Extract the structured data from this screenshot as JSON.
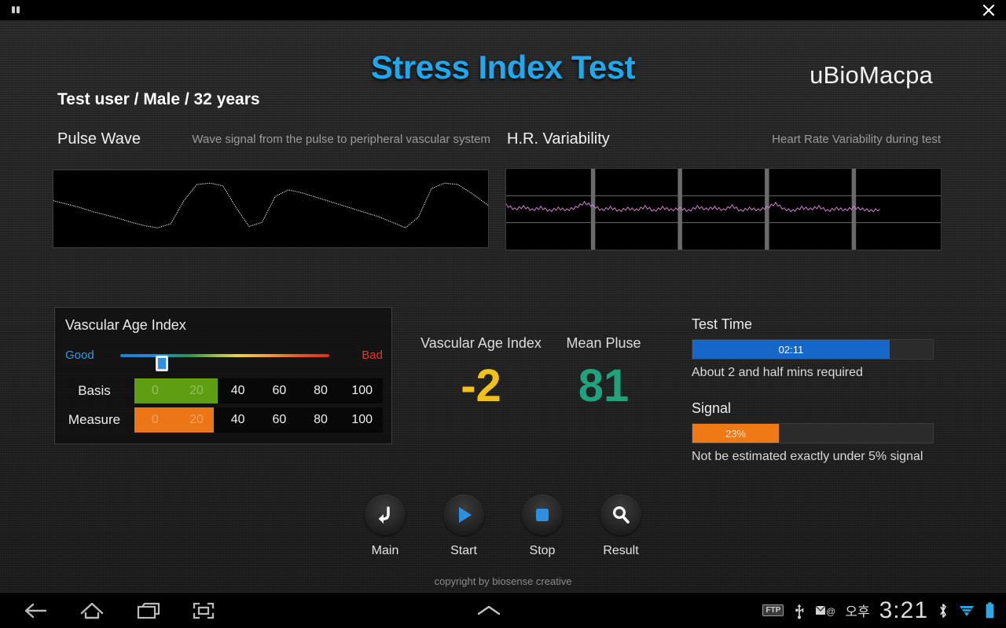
{
  "topbar": {
    "app_icon": "people-icon",
    "close_label": "close-icon"
  },
  "header": {
    "title": "Stress Index Test",
    "logo": "uBioMacpa",
    "user_info": "Test user / Male / 32 years",
    "accent_color": "#20a8ef"
  },
  "charts": {
    "pulse": {
      "title": "Pulse Wave",
      "subtitle": "Wave signal from the pulse to peripheral vascular system",
      "trace_color": "#ffffff"
    },
    "hrv": {
      "title": "H.R. Variability",
      "subtitle": "Heart Rate Variability during test",
      "trace_color": "#d07fd0",
      "grid_rows": 3,
      "grid_cols": 5
    }
  },
  "chart_data": [
    {
      "type": "line",
      "title": "Pulse Wave",
      "xlabel": "",
      "ylabel": "",
      "series": [
        {
          "name": "pulse",
          "color": "#ffffff",
          "x": [
            0,
            3,
            6,
            9,
            12,
            15,
            18,
            21,
            24,
            27,
            30,
            33,
            36,
            39,
            42,
            45,
            48,
            51,
            54,
            57,
            60,
            63,
            66,
            69,
            72,
            75,
            78,
            81,
            84,
            87,
            90,
            93,
            96,
            99,
            100
          ],
          "y": [
            62,
            57,
            52,
            46,
            41,
            36,
            30,
            25,
            22,
            28,
            62,
            86,
            88,
            84,
            52,
            24,
            30,
            68,
            78,
            74,
            68,
            62,
            56,
            50,
            44,
            38,
            30,
            22,
            38,
            80,
            88,
            86,
            74,
            60,
            55
          ]
        }
      ]
    },
    {
      "type": "line",
      "title": "H.R. Variability",
      "xlabel": "",
      "ylabel": "",
      "ylim": [
        0,
        100
      ],
      "grid": true,
      "series": [
        {
          "name": "hrv",
          "color": "#d07fd0",
          "x": [
            0,
            2,
            4,
            6,
            8,
            10,
            12,
            14,
            16,
            18,
            20,
            22,
            24,
            26,
            28,
            30,
            32,
            34,
            36,
            38,
            40,
            42,
            44,
            46,
            48,
            50,
            52,
            54,
            56,
            58,
            60,
            62,
            64,
            66,
            68,
            70,
            72,
            74,
            76,
            78,
            80,
            82,
            84,
            86
          ],
          "y": [
            55,
            50,
            53,
            49,
            52,
            48,
            51,
            49,
            52,
            58,
            54,
            49,
            52,
            48,
            51,
            49,
            53,
            48,
            52,
            49,
            51,
            48,
            53,
            50,
            52,
            49,
            54,
            48,
            51,
            49,
            52,
            57,
            50,
            48,
            52,
            50,
            53,
            48,
            51,
            49,
            52,
            50,
            48,
            50
          ]
        }
      ]
    }
  ],
  "vascular_panel": {
    "title": "Vascular Age Index",
    "slider": {
      "left_label": "Good",
      "right_label": "Bad",
      "value_percent": 20,
      "left_color": "#2e9bdc",
      "right_color": "#e03a2a"
    },
    "scale_labels": [
      "0",
      "20",
      "40",
      "60",
      "80",
      "100"
    ],
    "rows": [
      {
        "label": "Basis",
        "fill_percent": 33.5,
        "fill_color": "#5f9e12",
        "filled_cells": 2
      },
      {
        "label": "Measure",
        "fill_percent": 32.0,
        "fill_color": "#ec7615",
        "filled_cells": 2
      }
    ]
  },
  "readouts": [
    {
      "caption": "Vascular Age Index",
      "value": "-2",
      "color": "#f0c116"
    },
    {
      "caption": "Mean Pluse",
      "value": "81",
      "color": "#1fa37c"
    }
  ],
  "status_panel": {
    "test_time": {
      "label": "Test Time",
      "value": "02:11",
      "percent": 82,
      "note": "About 2 and half mins required",
      "color": "#1767c8"
    },
    "signal": {
      "label": "Signal",
      "value": "23%",
      "percent": 36,
      "note": "Not be estimated exactly under 5% signal",
      "color": "#ef7914"
    }
  },
  "controls": [
    {
      "label": "Main",
      "icon": "back-arrow-icon",
      "icon_color": "#ffffff"
    },
    {
      "label": "Start",
      "icon": "play-icon",
      "icon_color": "#2e8fe0"
    },
    {
      "label": "Stop",
      "icon": "stop-square-icon",
      "icon_color": "#2e8fe0"
    },
    {
      "label": "Result",
      "icon": "magnifier-icon",
      "icon_color": "#ffffff"
    }
  ],
  "copyright": "copyright by biosense creative",
  "navbar": {
    "buttons": [
      "back-icon",
      "home-icon",
      "recent-apps-icon",
      "screenshot-icon"
    ],
    "expand": "chevron-up-icon",
    "tray": {
      "ftp": "FTP",
      "usb": "usb-icon",
      "mail": "mail-at-icon",
      "ampm": "오후",
      "time": "3:21",
      "bluetooth": "bluetooth-icon",
      "wifi": "wifi-icon",
      "battery": "battery-icon"
    }
  }
}
